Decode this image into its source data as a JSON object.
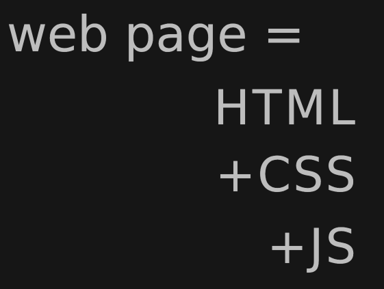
{
  "board": {
    "background": "#161616",
    "ink_color": "#bdbdbd",
    "lines": [
      "web page =",
      "HTML",
      "+CSS",
      "+JS"
    ]
  }
}
